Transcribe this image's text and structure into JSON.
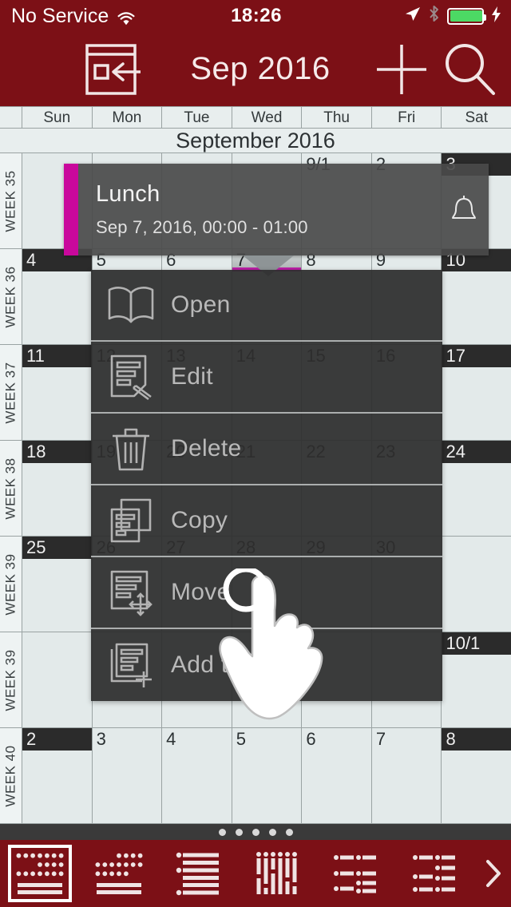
{
  "status_bar": {
    "carrier": "No Service",
    "wifi_icon": "wifi-icon",
    "time": "18:26",
    "location_icon": "location-arrow-icon",
    "bluetooth_icon": "bluetooth-icon",
    "battery_icon": "battery-icon",
    "charging_icon": "charging-bolt-icon"
  },
  "nav_bar": {
    "menu_icon": "hamburger-menu-icon",
    "jump_icon": "go-to-date-icon",
    "title": "Sep 2016",
    "add_icon": "plus-icon",
    "search_icon": "search-magnifier-icon"
  },
  "calendar": {
    "month_label": "September 2016",
    "weekdays": [
      "Sun",
      "Mon",
      "Tue",
      "Wed",
      "Thu",
      "Fri",
      "Sat"
    ],
    "accent_color": "#c9089c",
    "brand_color": "#7c1016",
    "cell_color": "#e3eaea",
    "weeks": [
      {
        "label": "WEEK 35",
        "days": [
          "",
          "",
          "",
          "",
          "9/1",
          "2",
          "3"
        ]
      },
      {
        "label": "WEEK 36",
        "days": [
          "4",
          "5",
          "6",
          "7",
          "8",
          "9",
          "10"
        ]
      },
      {
        "label": "WEEK 37",
        "days": [
          "11",
          "12",
          "13",
          "14",
          "15",
          "16",
          "17"
        ]
      },
      {
        "label": "WEEK 38",
        "days": [
          "18",
          "19",
          "20",
          "21",
          "22",
          "23",
          "24"
        ]
      },
      {
        "label": "WEEK 39",
        "days": [
          "25",
          "26",
          "27",
          "28",
          "29",
          "30",
          ""
        ]
      },
      {
        "label": "WEEK 39",
        "days": [
          "",
          "",
          "",
          "",
          "",
          "",
          "10/1"
        ]
      },
      {
        "label": "WEEK 40",
        "days": [
          "2",
          "3",
          "4",
          "5",
          "6",
          "7",
          "8"
        ]
      }
    ],
    "selected_day": "7"
  },
  "event_popup": {
    "title": "Lunch",
    "subtitle": "Sep 7, 2016, 00:00 - 01:00",
    "alarm_icon": "bell-alarm-icon"
  },
  "context_menu": {
    "items": [
      {
        "label": "Open",
        "icon": "open-book-icon"
      },
      {
        "label": "Edit",
        "icon": "document-pencil-icon"
      },
      {
        "label": "Delete",
        "icon": "trash-can-icon"
      },
      {
        "label": "Copy",
        "icon": "copy-documents-icon"
      },
      {
        "label": "Move",
        "icon": "document-move-arrows-icon"
      },
      {
        "label": "Add to",
        "icon": "document-plus-icon"
      }
    ]
  },
  "cursor": {
    "icon": "hand-pointer-icon"
  },
  "page_dots": {
    "count": 5,
    "active_index": 0
  },
  "toolbar": {
    "items": [
      {
        "name": "view-month-grid",
        "icon": "month-grid-icon",
        "selected": true
      },
      {
        "name": "view-month-compact",
        "icon": "month-compact-icon",
        "selected": false
      },
      {
        "name": "view-list-rows",
        "icon": "list-rows-icon",
        "selected": false
      },
      {
        "name": "view-week-columns",
        "icon": "week-columns-icon",
        "selected": false
      },
      {
        "name": "view-agenda-two",
        "icon": "agenda-two-col-icon",
        "selected": false
      },
      {
        "name": "view-agenda-detail",
        "icon": "agenda-detail-icon",
        "selected": false
      }
    ],
    "more_icon": "chevron-right-icon"
  }
}
